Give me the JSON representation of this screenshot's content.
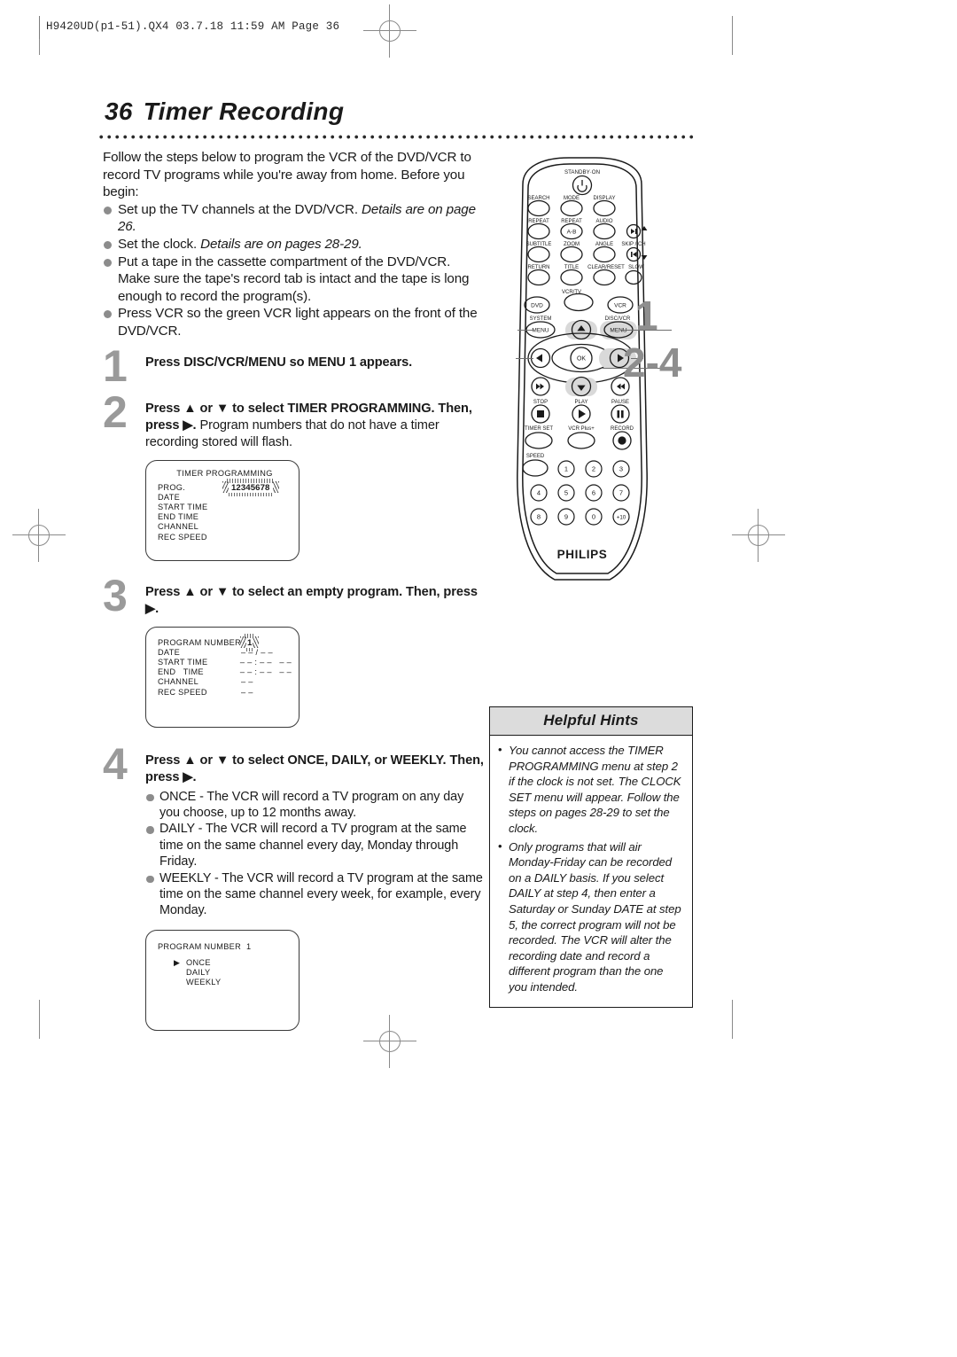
{
  "running_head": "H9420UD(p1-51).QX4  03.7.18  11:59 AM  Page 36",
  "title": {
    "number": "36",
    "text": "Timer Recording"
  },
  "intro": {
    "paragraph": "Follow the steps below to program the VCR of the DVD/VCR to record TV programs while you're away from home. Before you begin:",
    "bullets": [
      {
        "text": "Set up the TV channels at the DVD/VCR. ",
        "italic": "Details are on page 26."
      },
      {
        "text": "Set the clock. ",
        "italic": "Details are on pages 28-29."
      },
      {
        "text": "Put a tape in the cassette compartment of the DVD/VCR. Make sure the tape's record tab is intact and the tape is long enough to record the program(s).",
        "italic": ""
      },
      {
        "text": "Press VCR so the green VCR light appears on the front of the DVD/VCR.",
        "italic": ""
      }
    ]
  },
  "steps": [
    {
      "number": "1",
      "bold_lead": "Press DISC/VCR/MENU so MENU 1 appears.",
      "rest": ""
    },
    {
      "number": "2",
      "bold_lead": "Press ▲ or ▼ to select TIMER PROGRAMMING. Then, press ▶.",
      "rest": " Program numbers that do not have a timer recording stored will flash."
    },
    {
      "number": "3",
      "bold_lead": "Press ▲ or ▼ to select an empty program. Then, press ▶.",
      "rest": ""
    },
    {
      "number": "4",
      "bold_lead": "Press ▲ or ▼ to select ONCE, DAILY, or WEEKLY. Then, press ▶.",
      "rest": ""
    }
  ],
  "step4_bullets": [
    "ONCE - The VCR will record a TV program on any day you choose, up to 12 months away.",
    "DAILY - The VCR will record a TV program at the same time on the same channel every day, Monday through Friday.",
    "WEEKLY - The VCR will record a TV program at the same time on the same channel every week, for example, every Monday."
  ],
  "osd_screens": [
    {
      "title": "TIMER PROGRAMMING",
      "rows": [
        {
          "label": "PROG.",
          "value": "12345678",
          "flashing": true
        },
        {
          "label": "DATE",
          "value": ""
        },
        {
          "label": "START TIME",
          "value": ""
        },
        {
          "label": "END TIME",
          "value": ""
        },
        {
          "label": "CHANNEL",
          "value": ""
        },
        {
          "label": "REC SPEED",
          "value": ""
        }
      ]
    },
    {
      "title": "",
      "rows": [
        {
          "label": "PROGRAM NUMBER",
          "value": "1",
          "flashing": true
        },
        {
          "label": "DATE",
          "value": "– – / – –"
        },
        {
          "label": "START TIME",
          "value": "– – : – –   – –"
        },
        {
          "label": "END   TIME",
          "value": "– – : – –   – –"
        },
        {
          "label": "CHANNEL",
          "value": "– –"
        },
        {
          "label": "REC SPEED",
          "value": "– –"
        }
      ]
    },
    {
      "title": "",
      "header_label": "PROGRAM NUMBER",
      "header_value": "1",
      "options": [
        "ONCE",
        "DAILY",
        "WEEKLY"
      ],
      "selected": "ONCE",
      "cursor": "▶"
    }
  ],
  "hints": {
    "heading": "Helpful Hints",
    "items": [
      "You cannot access the TIMER PROGRAMMING menu at step 2 if the clock is not set. The CLOCK SET menu will appear. Follow the steps on pages 28-29 to set the clock.",
      "Only programs that will air Monday-Friday can be recorded on a DAILY basis. If you select DAILY at step 4, then enter a Saturday or Sunday DATE at step 5, the correct program will not be recorded. The VCR will alter the recording date and record a different program than the one you intended."
    ]
  },
  "remote": {
    "brand": "PHILIPS",
    "standby_label": "STANDBY·ON",
    "callouts": [
      "1",
      "2-4"
    ],
    "button_labels": {
      "row1": [
        "SEARCH",
        "MODE",
        "DISPLAY"
      ],
      "row2": [
        "REPEAT",
        "REPEAT",
        "AUDIO"
      ],
      "row2_inner": "A-B",
      "row3": [
        "SUBTITLE",
        "ZOOM",
        "ANGLE"
      ],
      "skip_ch": "SKIP / CH",
      "row4": [
        "RETURN",
        "TITLE",
        "CLEAR/RESET",
        "SLOW"
      ],
      "vcr_tv": "VCR/TV",
      "dvd": "DVD",
      "vcr": "VCR",
      "system_menu_label": "SYSTEM",
      "disc_vcr_menu_label": "DISC/VCR",
      "menu": "MENU",
      "ok": "OK",
      "transport": [
        "STOP",
        "PLAY",
        "PAUSE"
      ],
      "row_timer": [
        "TIMER SET",
        "VCR Plus+",
        "RECORD"
      ],
      "speed": "SPEED",
      "numbers": [
        "1",
        "2",
        "3",
        "4",
        "5",
        "6",
        "7",
        "8",
        "9",
        "0",
        "+10"
      ]
    }
  },
  "colors": {
    "accent_gray": "#9a9a9a",
    "bullet_gray": "#8c8c8c",
    "hint_header_bg": "#dcdcdc",
    "text": "#1a1a1a"
  }
}
